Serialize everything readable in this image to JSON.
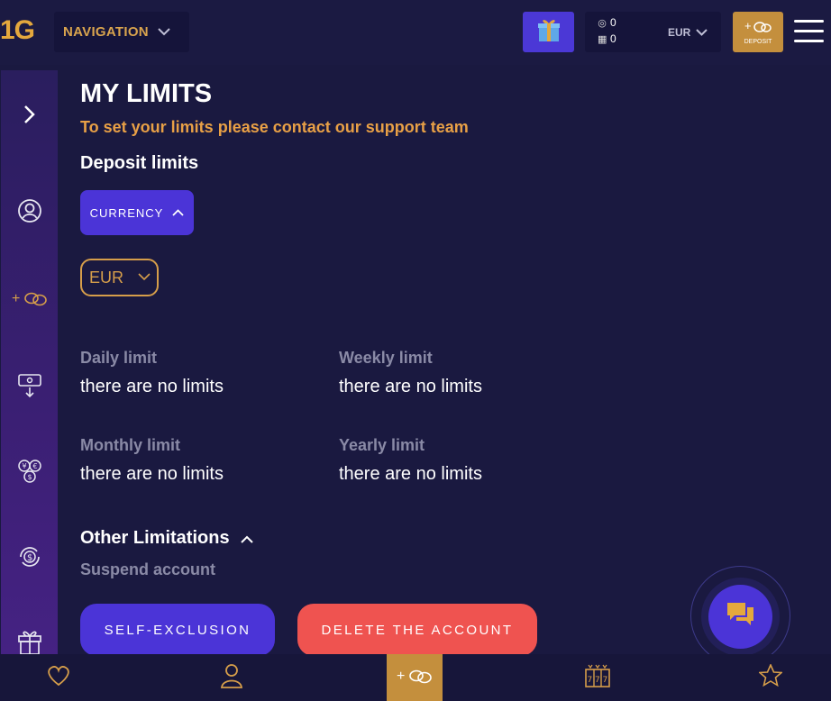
{
  "header": {
    "logo": "1G",
    "navigation_label": "NAVIGATION",
    "balance_value": "0",
    "bonus_value": "0",
    "currency": "EUR",
    "deposit_label": "DEPOSIT"
  },
  "main": {
    "title": "MY LIMITS",
    "subtitle": "To set your limits please contact our support team",
    "deposit_limits_heading": "Deposit limits",
    "currency_toggle_label": "CURRENCY",
    "currency_selected": "EUR",
    "limits": [
      {
        "label": "Daily limit",
        "value": "there are no limits"
      },
      {
        "label": "Weekly limit",
        "value": "there are no limits"
      },
      {
        "label": "Monthly limit",
        "value": "there are no limits"
      },
      {
        "label": "Yearly limit",
        "value": "there are no limits"
      }
    ],
    "other_limitations_heading": "Other Limitations",
    "suspend_account_label": "Suspend account",
    "self_exclusion_label": "SELF-EXCLUSION",
    "delete_account_label": "DELETE THE ACCOUNT"
  },
  "colors": {
    "background": "#1a1940",
    "accent_purple": "#4b34d7",
    "accent_gold": "#c48f3d",
    "subtitle_orange": "#e8a046",
    "danger_red": "#ef5350",
    "muted_text": "#8a8aa6"
  },
  "icons": {
    "sidebar": [
      "chevron-right-icon",
      "profile-icon",
      "deposit-coins-icon",
      "withdraw-icon",
      "currency-exchange-icon",
      "bonus-cycle-icon",
      "gift-icon"
    ],
    "bottom": [
      "heart-icon",
      "user-icon",
      "deposit-coins-icon",
      "slots-icon",
      "star-icon"
    ]
  }
}
